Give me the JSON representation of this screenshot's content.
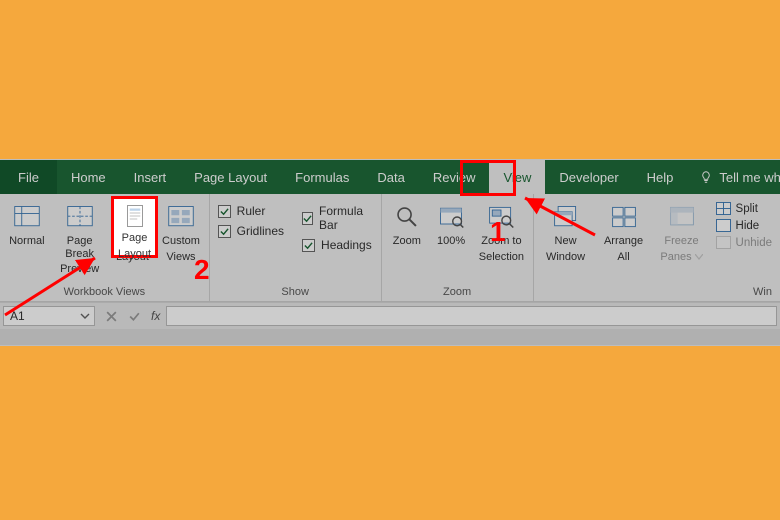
{
  "tabs": {
    "file": "File",
    "home": "Home",
    "insert": "Insert",
    "page_layout": "Page Layout",
    "formulas": "Formulas",
    "data": "Data",
    "review": "Review",
    "view": "View",
    "developer": "Developer",
    "help": "Help",
    "tell_me": "Tell me what you"
  },
  "groups": {
    "workbook_views": {
      "label": "Workbook Views",
      "normal": "Normal",
      "page_break_l1": "Page Break",
      "page_break_l2": "Preview",
      "page_layout_l1": "Page",
      "page_layout_l2": "Layout",
      "custom_views_l1": "Custom",
      "custom_views_l2": "Views"
    },
    "show": {
      "label": "Show",
      "ruler": "Ruler",
      "gridlines": "Gridlines",
      "formula_bar": "Formula Bar",
      "headings": "Headings"
    },
    "zoom": {
      "label": "Zoom",
      "zoom": "Zoom",
      "hundred": "100%",
      "zts_l1": "Zoom to",
      "zts_l2": "Selection"
    },
    "window": {
      "label": "Win",
      "new_l1": "New",
      "new_l2": "Window",
      "arrange_l1": "Arrange",
      "arrange_l2": "All",
      "freeze_l1": "Freeze",
      "freeze_l2": "Panes",
      "split": "Split",
      "hide": "Hide",
      "unhide": "Unhide"
    }
  },
  "namebox": {
    "value": "A1"
  },
  "fx": {
    "label": "fx"
  },
  "anno": {
    "n1": "1",
    "n2": "2"
  }
}
